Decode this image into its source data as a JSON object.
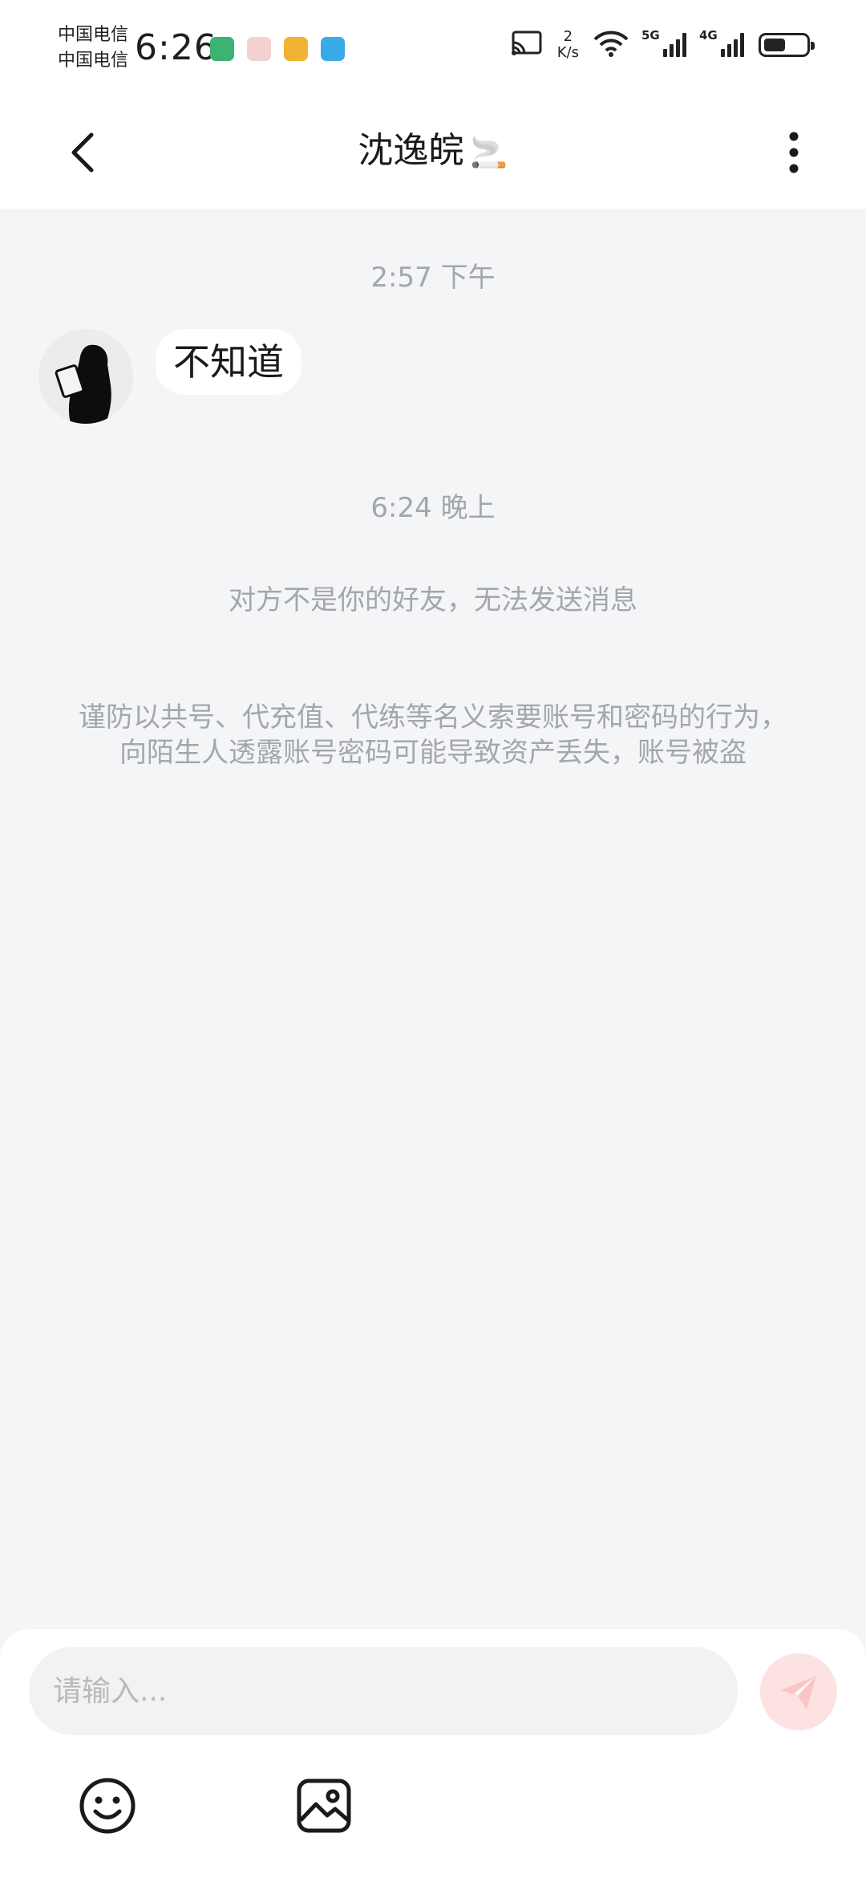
{
  "status_bar": {
    "carrier_1": "中国电信",
    "carrier_2": "中国电信",
    "time": "6:26",
    "net_speed_value": "2",
    "net_speed_unit": "K/s",
    "signal_1": "5G",
    "signal_2": "4G",
    "battery_level": 0.5,
    "app_icon_colors": [
      "#3cb371",
      "#f3d1d1",
      "#f2b233",
      "#3aa9e8"
    ]
  },
  "header": {
    "title": "沈逸皖",
    "title_emoji": "🚬"
  },
  "messages": {
    "time_1": "2:57 下午",
    "bubble_text": "不知道",
    "time_2": "6:24 晚上",
    "system_notice": "对方不是你的好友，无法发送消息",
    "security_warning": "谨防以共号、代充值、代练等名义索要账号和密码的行为，向陌生人透露账号密码可能导致资产丢失，账号被盗"
  },
  "composer": {
    "placeholder": "请输入...",
    "send_color": "#f26b6b"
  },
  "icons": {
    "back": "chevron-left-icon",
    "more": "more-vertical-icon",
    "send": "paper-plane-icon",
    "emoji": "smiley-icon",
    "image": "image-icon"
  }
}
